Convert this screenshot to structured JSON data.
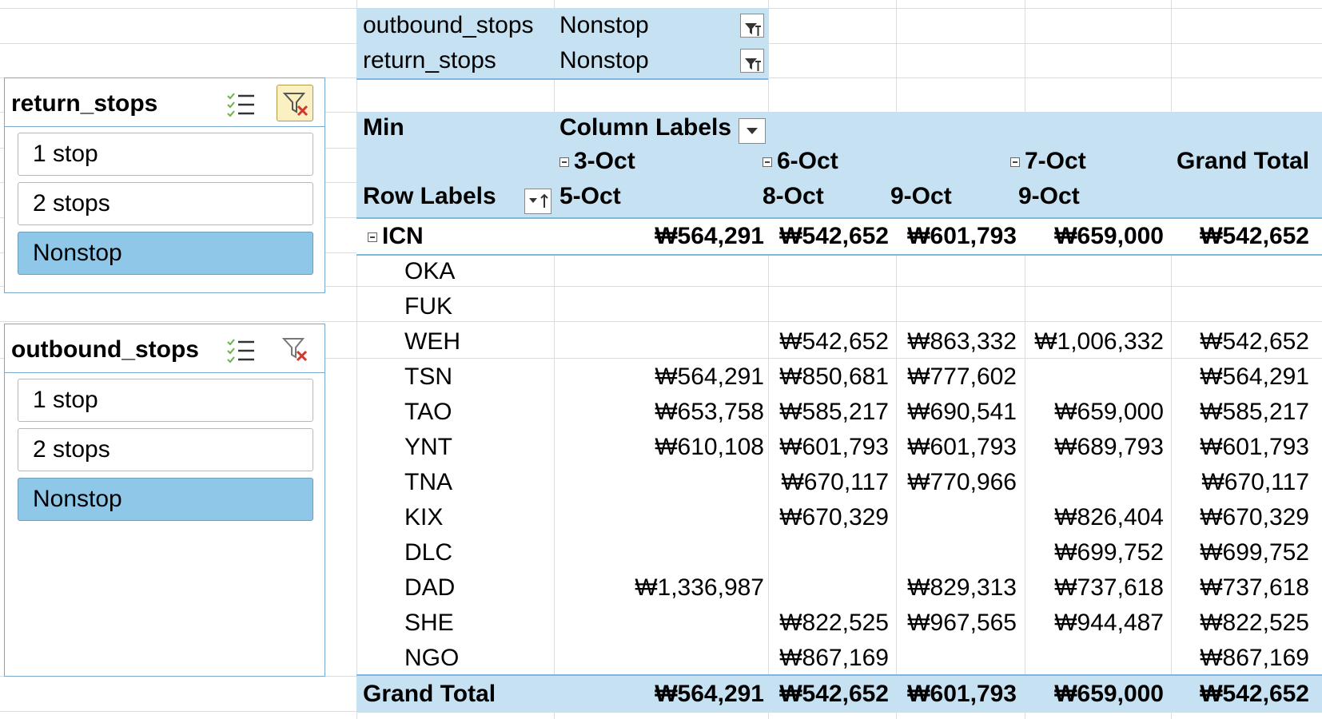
{
  "filters": [
    {
      "name": "outbound_stops",
      "value": "Nonstop"
    },
    {
      "name": "return_stops",
      "value": "Nonstop"
    }
  ],
  "pivot": {
    "value_label": "Min",
    "column_labels": "Column Labels",
    "row_labels": "Row Labels",
    "grand_total_col": "Grand Total",
    "groups": [
      {
        "label": "3-Oct",
        "sub": [
          "5-Oct"
        ]
      },
      {
        "label": "6-Oct",
        "sub": [
          "8-Oct",
          "9-Oct"
        ]
      },
      {
        "label": "7-Oct",
        "sub": [
          "9-Oct"
        ]
      }
    ],
    "parent_row": {
      "label": "ICN",
      "values": [
        "₩564,291",
        "₩542,652",
        "₩601,793",
        "₩659,000",
        "₩542,652"
      ]
    },
    "rows": [
      {
        "label": "OKA",
        "values": [
          "",
          "",
          "",
          "",
          ""
        ]
      },
      {
        "label": "FUK",
        "values": [
          "",
          "",
          "",
          "",
          ""
        ]
      },
      {
        "label": "WEH",
        "values": [
          "",
          "₩542,652",
          "₩863,332",
          "₩1,006,332",
          "₩542,652"
        ]
      },
      {
        "label": "TSN",
        "values": [
          "₩564,291",
          "₩850,681",
          "₩777,602",
          "",
          "₩564,291"
        ]
      },
      {
        "label": "TAO",
        "values": [
          "₩653,758",
          "₩585,217",
          "₩690,541",
          "₩659,000",
          "₩585,217"
        ]
      },
      {
        "label": "YNT",
        "values": [
          "₩610,108",
          "₩601,793",
          "₩601,793",
          "₩689,793",
          "₩601,793"
        ]
      },
      {
        "label": "TNA",
        "values": [
          "",
          "₩670,117",
          "₩770,966",
          "",
          "₩670,117"
        ]
      },
      {
        "label": "KIX",
        "values": [
          "",
          "₩670,329",
          "",
          "₩826,404",
          "₩670,329"
        ]
      },
      {
        "label": "DLC",
        "values": [
          "",
          "",
          "",
          "₩699,752",
          "₩699,752"
        ]
      },
      {
        "label": "DAD",
        "values": [
          "₩1,336,987",
          "",
          "₩829,313",
          "₩737,618",
          "₩737,618"
        ]
      },
      {
        "label": "SHE",
        "values": [
          "",
          "₩822,525",
          "₩967,565",
          "₩944,487",
          "₩822,525"
        ]
      },
      {
        "label": "NGO",
        "values": [
          "",
          "₩867,169",
          "",
          "",
          "₩867,169"
        ]
      }
    ],
    "grand_total_row": {
      "label": "Grand Total",
      "values": [
        "₩564,291",
        "₩542,652",
        "₩601,793",
        "₩659,000",
        "₩542,652"
      ]
    }
  },
  "slicers": [
    {
      "title": "return_stops",
      "items": [
        "1 stop",
        "2 stops",
        "Nonstop"
      ],
      "selected": "Nonstop",
      "filter_active": true
    },
    {
      "title": "outbound_stops",
      "items": [
        "1 stop",
        "2 stops",
        "Nonstop"
      ],
      "selected": "Nonstop",
      "filter_active": false
    }
  ],
  "colors": {
    "header_bg": "#c6e1f2",
    "selected_item": "#8fc7e8",
    "border": "#7db8dc",
    "clear_active": "#fbf0c2"
  }
}
